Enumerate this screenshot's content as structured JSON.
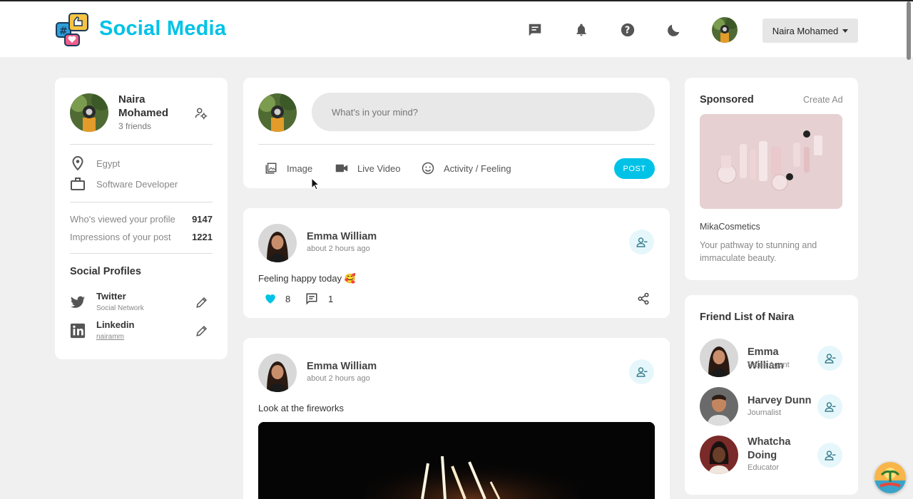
{
  "header": {
    "brand": "Social Media",
    "user_name": "Naira Mohamed",
    "icons": [
      "chat-icon",
      "bell-icon",
      "help-icon",
      "moon-icon"
    ],
    "accent": "#00c2e6"
  },
  "profile": {
    "name": "Naira Mohamed",
    "friends": "3 friends",
    "location": "Egypt",
    "occupation": "Software Developer",
    "stats": [
      {
        "label": "Who's viewed your profile",
        "value": "9147"
      },
      {
        "label": "Impressions of your post",
        "value": "1221"
      }
    ],
    "social_title": "Social Profiles",
    "socials": [
      {
        "name": "Twitter",
        "sub": "Social Network"
      },
      {
        "name": "Linkedin",
        "sub": "nairamm"
      }
    ]
  },
  "composer": {
    "placeholder": "What's in your mind?",
    "actions": [
      "Image",
      "Live Video",
      "Activity / Feeling"
    ],
    "post_label": "POST"
  },
  "posts": [
    {
      "author": "Emma William",
      "time": "about 2 hours ago",
      "text": "Feeling happy today 🥰",
      "likes": "8",
      "comments": "1"
    },
    {
      "author": "Emma William",
      "time": "about 2 hours ago",
      "text": "Look at the fireworks"
    }
  ],
  "sponsored": {
    "title": "Sponsored",
    "create": "Create Ad",
    "brand": "MikaCosmetics",
    "desc": "Your pathway to stunning and immaculate beauty."
  },
  "friends": {
    "title": "Friend List of Naira",
    "list": [
      {
        "name": "Emma William",
        "role": "Sales Agent"
      },
      {
        "name": "Harvey Dunn",
        "role": "Journalist"
      },
      {
        "name": "Whatcha Doing",
        "role": "Educator"
      }
    ]
  }
}
